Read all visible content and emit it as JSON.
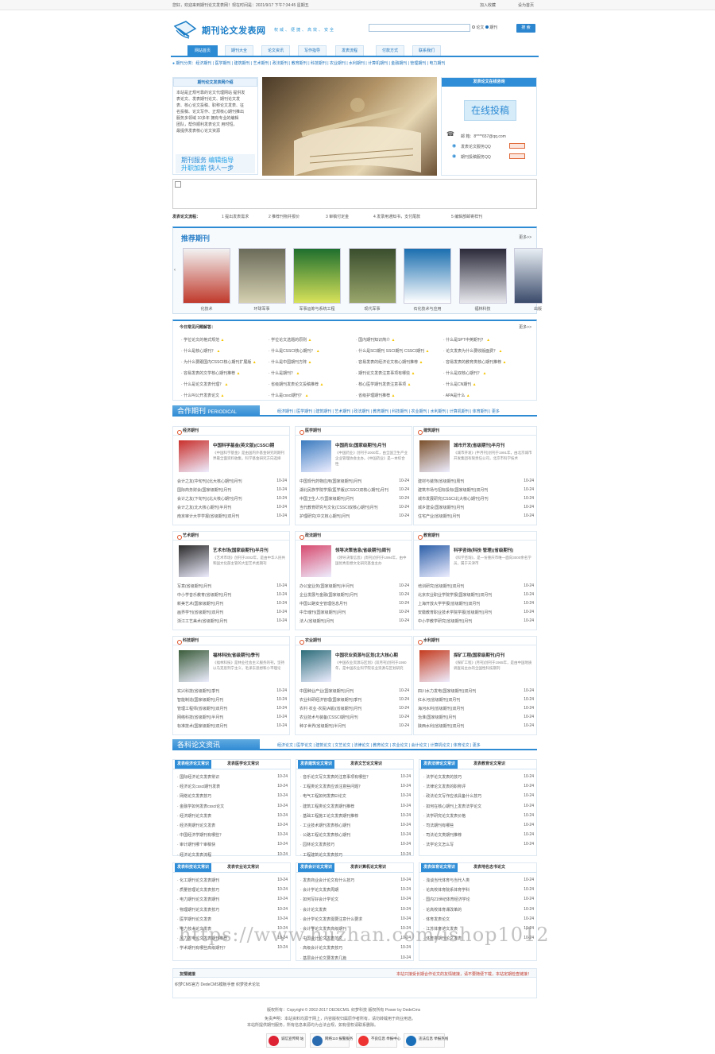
{
  "topbar": {
    "greeting": "您好，欢迎来到期刊论文发表网！现在时间是：2021/9/17 下午7:34:45 星期五",
    "fav": "加入收藏",
    "home": "设为首页"
  },
  "header": {
    "logo": "期刊论文发表网",
    "slogan": "权威、便捷、高效、安全",
    "radio1": "论文",
    "radio2": "期刊",
    "search_btn": "搜 索"
  },
  "nav": [
    "网站首页",
    "期刊大全",
    "论文资讯",
    "写作指导",
    "发表流程",
    "付款方式",
    "联系我们"
  ],
  "subnav": "期刊分类：经济期刊 | 医学期刊 | 建筑期刊 | 艺术期刊 | 政法期刊 | 教育期刊 | 科技期刊 | 农业期刊 | 水利期刊 | 计算机期刊 | 金融期刊 | 管理期刊 | 电力期刊",
  "intro": {
    "title": "期刊论文发表网介绍",
    "text": [
      "本站是正规可靠的论文代理网站 提供发",
      "表论文、发表期刊论文、期刊论文发",
      "表、核心论文投稿、职称论文发表、征",
      "名投稿、论文写作、正规核心期刊推出",
      "服务多领域 10多年 拥有专业的编辑",
      "团队，帮你顺利发表论文 用时短，",
      "最提供发表核心论文资源"
    ],
    "service1": "期刊服务",
    "service2": "编辑指导",
    "service3": "升职加薪",
    "service4": "快人一步"
  },
  "submit": {
    "title": "发表论文在线咨询",
    "btn": "在线投稿",
    "email_label": "邮 箱：",
    "email": "8****657@qq.com",
    "qq1": "发表论文服务QQ",
    "qq2": "期刊投稿服务QQ"
  },
  "process": {
    "label": "发表论文流程：",
    "steps": [
      "1 提出发表需求",
      "2 推荐刊物并报价",
      "3 审稿付定金",
      "4 发录用通知书，支付尾款",
      "5 编辑部邮寄样刊"
    ]
  },
  "recommend": {
    "title": "推荐期刊",
    "more": "更多>>",
    "items": [
      "化技术",
      "环球军事",
      "军事运筹与系统工程",
      "现代军事",
      "石化技术与应用",
      "福林科技",
      "出版"
    ]
  },
  "faq": {
    "title": "今日常见问题解答：",
    "more": "更多>>",
    "cols": [
      [
        "学位论文的格式规范",
        "什么是核心期刊？",
        "为什么要跟国内CSSCI核心期刊扩展版",
        "容易发表的文学核心期刊推荐",
        "什么是论文发表代理？",
        "什么叫公开发表论文"
      ],
      [
        "学位论文选题的原则",
        "什么是CSSCI核心期刊？",
        "什么是中国期刊方阵",
        "什么是期刊？",
        "省级期刊发表论文投稿推荐",
        "什么是cssci期刊？"
      ],
      [
        "国内期刊知识简介",
        "什么是SCI期刊 SSCI期刊 CSSCI期刊",
        "容易发表的经济论文核心期刊推荐",
        "期刊论文发表注意事项有哪些",
        "核心医学期刊发表注意事项",
        "省级护理期刊推荐"
      ],
      [
        "什么是SPT中英期刊？",
        "论文发表为什么要收版面费？",
        "容易发表的教育类核心期刊推荐",
        "什么是双核心期刊？",
        "什么是CN期刊",
        "APA是什么"
      ]
    ]
  },
  "coop": {
    "title": "合作期刊",
    "sub": "PERIODICAL",
    "cats": "经济期刊 | 医学期刊 | 建筑期刊 | 艺术期刊 | 政法期刊 | 教育期刊 | 科技期刊 | 农业期刊 | 水利期刊 | 计算机期刊 | 体育期刊 | 更多"
  },
  "categories": [
    {
      "title": "经济期刊",
      "feat": "中国科学基金(英文版)(CSSCI期",
      "desc": "《中国科学基金》是由国内外基金研究的期刊界最全面资料收集，科学基金研究方向选择",
      "rows": [
        "会计之友(中旬刊)(北大核心期刊)月刊",
        "国际商务财会(国家级期刊)月刊",
        "会计之友(下旬刊)(北大核心期刊)月刊",
        "会计之友(北大核心期刊)半月刊",
        "南京审计大学学报(省级期刊)双月刊"
      ]
    },
    {
      "title": "医学期刊",
      "feat": "中国药业(国家级期刊)月刊",
      "desc": "《中国药业》创刊于2000年，由全国卫生产业企业管理协会主办。《中国药业》是一本综合性",
      "rows": [
        "中国现代药物应用(国家级期刊)月刊",
        "湖北民族学院学报(医学版)(CSSCI双核心期刊)月刊",
        "中国卫生人才(国家级期刊)月刊",
        "当代教育研究与文化(CSSCI双核心期刊)月刊",
        "护理研究(中文核心期刊)月刊"
      ]
    },
    {
      "title": "建筑期刊",
      "feat": "城市开发(省级期刊)半月刊",
      "desc": "《城市开发》(半月刊)创刊于1991年，由北京城市开发集团有限责任公司，北京市科学技术",
      "rows": [
        "建材与装饰(省级期刊)周刊",
        "建筑市场与招标投标(国家级期刊)双月刊",
        "城市发展研究(CSSCI北大核心期刊)月刊",
        "城乡建设(国家级期刊)月刊",
        "住宅产业(省级期刊)月刊"
      ]
    },
    {
      "title": "艺术期刊",
      "feat": "艺术市场(国家级期刊)半月刊",
      "desc": "《艺术市场》创刊于2002年，是由中华人民共和国文化部主管的大型艺术类期刊",
      "rows": [
        "写意(省级期刊)月刊",
        "中小学音乐教育(省级期刊)月刊",
        "新美艺术(国家级期刊)月刊",
        "画界学刊(省级期刊)双月刊",
        "浙江工艺美术(省级期刊)月刊"
      ]
    },
    {
      "title": "政法期刊",
      "feat": "领导决策信息(省级期刊)周刊",
      "desc": "《领导决策信息》(周刊)创刊于1994年，由中国优秀思想文化研究基金主办",
      "rows": [
        "办公室业务(国家级期刊)半月刊",
        "企业发展与金融(国家级期刊)月刊",
        "中国公路安全管理信息月刊",
        "中华魂刊(国家级期刊)月刊",
        "法人(省级期刊)月刊"
      ]
    },
    {
      "title": "教育期刊",
      "feat": "科学咨询(科技·管理)(省级期刊)",
      "desc": "《科学咨询》，是一份重庆市唯一面向3000余名学员，属于天津市",
      "rows": [
        "培训研究(省级期刊)双月刊",
        "北京农业职业学院学报(国家级期刊)双月刊",
        "上海开放大学学报(省级期刊)双月刊",
        "安徽教育职业技术学院学报(省级期刊)月刊",
        "中小学教学研究(省级期刊)月刊"
      ]
    },
    {
      "title": "科技期刊",
      "feat": "福林科技(省级期刊)季刊",
      "desc": "《福林科技》是林业社会主义服务的刊，坚持以马克思列宁主义，毛泽东思想和小平理论",
      "rows": [
        "实兴科技(省级期刊)季刊",
        "智能制造(国家级期刊)月刊",
        "管理工程师(省级期刊)双月刊",
        "网络科技(省级期刊)半月刊",
        "标准技术(国家级期刊)双月刊"
      ]
    },
    {
      "title": "农业期刊",
      "feat": "中国农业资源与区划(北大核心期",
      "desc": "《中国农业资源与区划》(双月刊)创刊于1980年，是中国农业科学院农业资源与区划研究",
      "rows": [
        "中国种业产业(国家级期刊)月刊",
        "农业科研经济管理(国家级期刊)季刊",
        "农村·农业·农民(A版)(省级期刊)月刊",
        "农业技术与装备(CSSCI期刊)月刊",
        "种子世界(省级期刊)半月刊"
      ]
    },
    {
      "title": "水利期刊",
      "feat": "探矿工程(国家级期刊)月刊",
      "desc": "《探矿工程》(月刊)创刊于1965年，是由中国地质调查局主办的全国性科技期刊",
      "rows": [
        "四川水力发电(国家级期刊)双月刊",
        "红水河(省级期刊)双月刊",
        "海河水利(省级期刊)双月刊",
        "治淮(国家级期刊)月刊",
        "陕西水利(省级期刊)双月刊"
      ]
    }
  ],
  "dates": "10-24",
  "articles": {
    "title": "各科论文资讯",
    "cats": "经济论文 | 医学论文 | 建筑论文 | 文艺论文 | 法律论文 | 教育论文 | 农业论文 | 会计论文 | 计算机论文 | 体育论文 | 更多"
  },
  "tabs": [
    {
      "on": "发表经济论文常识",
      "off": "发表医学论文常识",
      "rows": [
        "国际经济论文发表常识",
        "经济论文cssci期刊发表",
        "网络论文发表技巧",
        "金融学如何发表cssci论文",
        "经济期刊论文发表",
        "经济类期刊论文发表",
        "中国经济学期刊有哪些？",
        "审计期刊哪个审稿快",
        "经济论文发表流程"
      ]
    },
    {
      "on": "发表建筑论文常识",
      "off": "发表文艺论文常识",
      "rows": [
        "音乐论文写文发表的注意事项有哪些？",
        "工程类论文发表应该注意些问题？",
        "电气工程如何发表EI论文",
        "建筑工程类论文发表期刊推荐",
        "基础工程施工论文发表期刊推荐",
        "工业技术期刊发表核心期刊",
        "公路工程论文发表核心期刊",
        "园林论文发表技巧",
        "工程建筑论文发表技巧"
      ]
    },
    {
      "on": "发表法律论文常识",
      "off": "发表教育论文常识",
      "rows": [
        "法学论文发表的技巧",
        "法律论文发表的职称评",
        "政法论文写作应该具备什么技巧",
        "如何在核心期刊上发表法学论文",
        "法学研究论文发表价格",
        "司法期刊有哪些",
        "司法论文类期刊推荐",
        "法学论文怎么写"
      ]
    },
    {
      "on": "发表科技论文常识",
      "off": "发表农业论文常识",
      "rows": [
        "化工期刊论文发表期刊",
        "质量管理论文发表技巧",
        "电力期刊论文发表期刊",
        "物理期刊论文发表技巧",
        "医学期刊论文发表",
        "电力技术论文发表",
        "风力发电论文发表期刊推荐",
        "学术期刊有哪些高级期刊？"
      ]
    },
    {
      "on": "发表会计论文常识",
      "off": "发表计算机论文常识",
      "rows": [
        "发表商业会计论文有什么技巧",
        "会计学论文发表周期",
        "如何写好会计学论文",
        "会计论文发表",
        "会计学论文发表需要注意什么要求",
        "会计学论文发表高级期刊",
        "中国会计论文发表范文",
        "高级会计论文发表技巧",
        "基层会计论文要发表几篇"
      ]
    },
    {
      "on": "发表体育论文常识",
      "off": "发表地名志书论文",
      "rows": [
        "浅谈当代体育与当代人类",
        "论高校体育院系体育学科",
        "国内21世纪体育经济学论",
        "论高校体育课改革的",
        "体育发表论文",
        "江苏体育论文发表",
        "体育类期刊论文发表"
      ]
    }
  ],
  "links": {
    "title": "友情链接",
    "note": "本站只接受长期合作论文的友情链接，请不要随便下载，本站定期检查链接！",
    "items": "织梦CMS官方 DedeCMS模板手册 织梦技术论坛"
  },
  "footer": {
    "line1": "版权所有：Copyright © 2002-2017 DEDECMS. 织梦科技 版权所有 Power by DedeCms",
    "line2": "免责声明：本站资料均源于网上，内容版权归属原作者所有，请勿转载用于商业用途。",
    "line3": "本站所提供期刊服务，所有信息来源均为合法合规，如有侵权请联系删除。",
    "badges": [
      "诚信宣传网 站",
      "网络110 报警服务",
      "不良信息 举报中心",
      "违法信息 举报热线"
    ]
  },
  "watermark": "https://www.huzhan.com/ishop1012",
  "colors": {
    "accent": "#2d8bd4",
    "highlight": "#f5c400",
    "red": "#e0542a"
  }
}
